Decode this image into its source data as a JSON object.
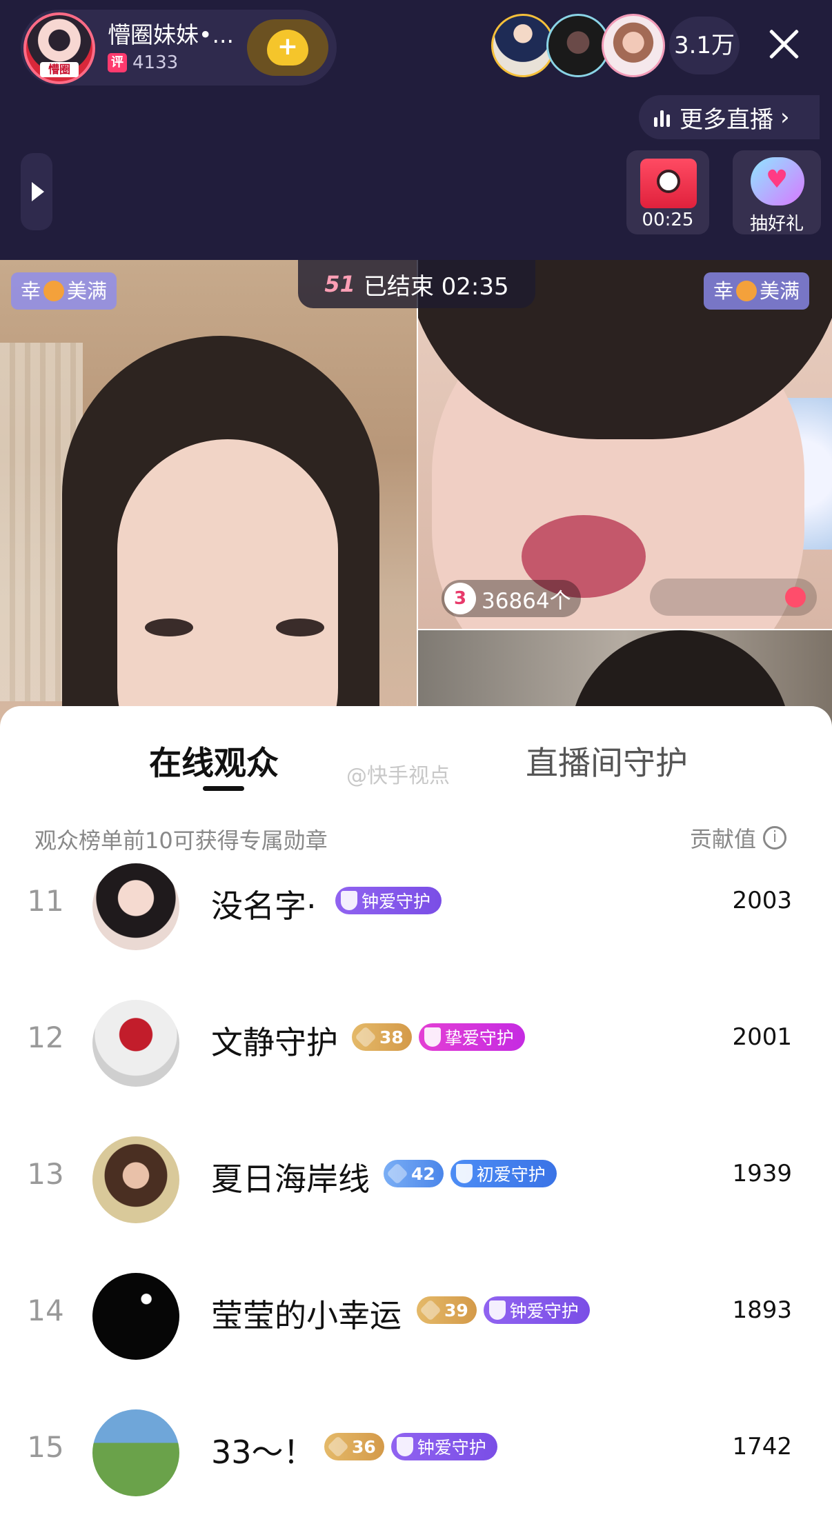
{
  "header": {
    "host_name": "懵圈妹妹•...",
    "host_avatar_tag": "懵圈",
    "rating_badge": "评",
    "rating_count": "4133",
    "follow_symbol": "+",
    "viewer_count": "3.1万",
    "more_live": "更多直播",
    "timer": "00:25",
    "gift_label": "抽好礼"
  },
  "video": {
    "tag_left": {
      "pre": "幸",
      "post": "美满"
    },
    "tag_right": {
      "pre": "幸",
      "post": "美满"
    },
    "status_logo": "51",
    "status_text": "已结束 02:35",
    "gift_rank": "3",
    "gift_count": "36864个"
  },
  "panel": {
    "tabs": {
      "online": "在线观众",
      "guard": "直播间守护"
    },
    "watermark": "@快手视点",
    "hint": "观众榜单前10可获得专属勋章",
    "contribution_label": "贡献值",
    "info_icon": "i",
    "rows": [
      {
        "rank": "11",
        "name": "没名字·",
        "level": "",
        "guard": "钟爱守护",
        "score": "2003"
      },
      {
        "rank": "12",
        "name": "文静守护",
        "level": "38",
        "guard": "挚爱守护",
        "score": "2001"
      },
      {
        "rank": "13",
        "name": "夏日海岸线",
        "level": "42",
        "guard": "初爱守护",
        "score": "1939"
      },
      {
        "rank": "14",
        "name": "莹莹的小幸运",
        "level": "39",
        "guard": "钟爱守护",
        "score": "1893"
      },
      {
        "rank": "15",
        "name": "33～！",
        "level": "36",
        "guard": "钟爱守护",
        "score": "1742"
      }
    ]
  }
}
